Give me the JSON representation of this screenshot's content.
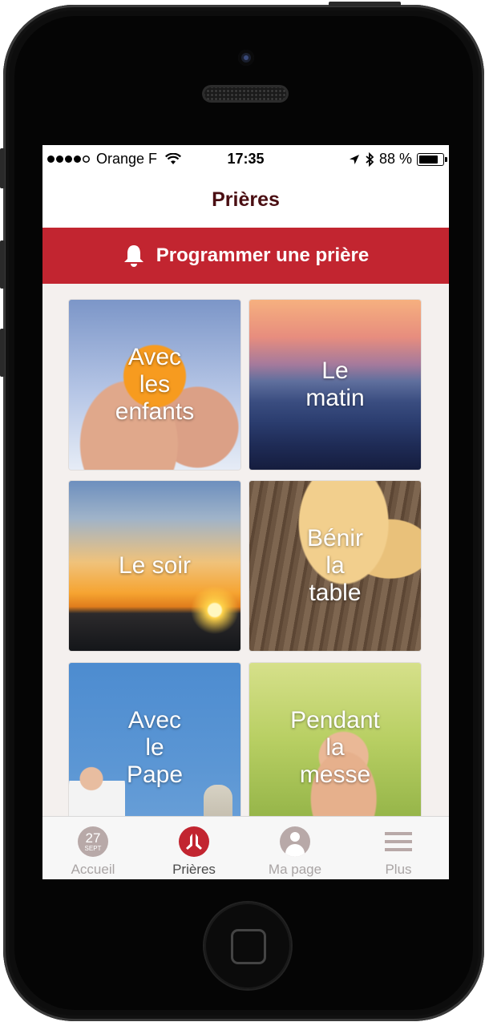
{
  "status_bar": {
    "carrier": "Orange F",
    "time": "17:35",
    "battery_percent": "88 %",
    "battery_level": 0.88,
    "signal_icon": "signal-dots",
    "wifi_icon": "wifi-icon",
    "location_icon": "location-arrow-icon",
    "bluetooth_icon": "bluetooth-icon"
  },
  "nav": {
    "title": "Prières"
  },
  "banner": {
    "label": "Programmer une prière",
    "icon": "bell-icon"
  },
  "tiles": [
    {
      "label": "Avec\nles\nenfants"
    },
    {
      "label": "Le\nmatin"
    },
    {
      "label": "Le soir"
    },
    {
      "label": "Bénir\nla\ntable"
    },
    {
      "label": "Avec\nle\nPape"
    },
    {
      "label": "Pendant\nla\nmesse"
    }
  ],
  "tabbar": {
    "items": [
      {
        "label": "Accueil",
        "icon": "calendar-icon",
        "day": "27",
        "month": "SEPT"
      },
      {
        "label": "Prières",
        "icon": "praying-hands-icon"
      },
      {
        "label": "Ma page",
        "icon": "person-icon"
      },
      {
        "label": "Plus",
        "icon": "menu-icon"
      }
    ],
    "active_index": 1
  },
  "colors": {
    "accent": "#c22530",
    "title": "#4a0e12",
    "tab_inactive": "#b8a9a8"
  }
}
